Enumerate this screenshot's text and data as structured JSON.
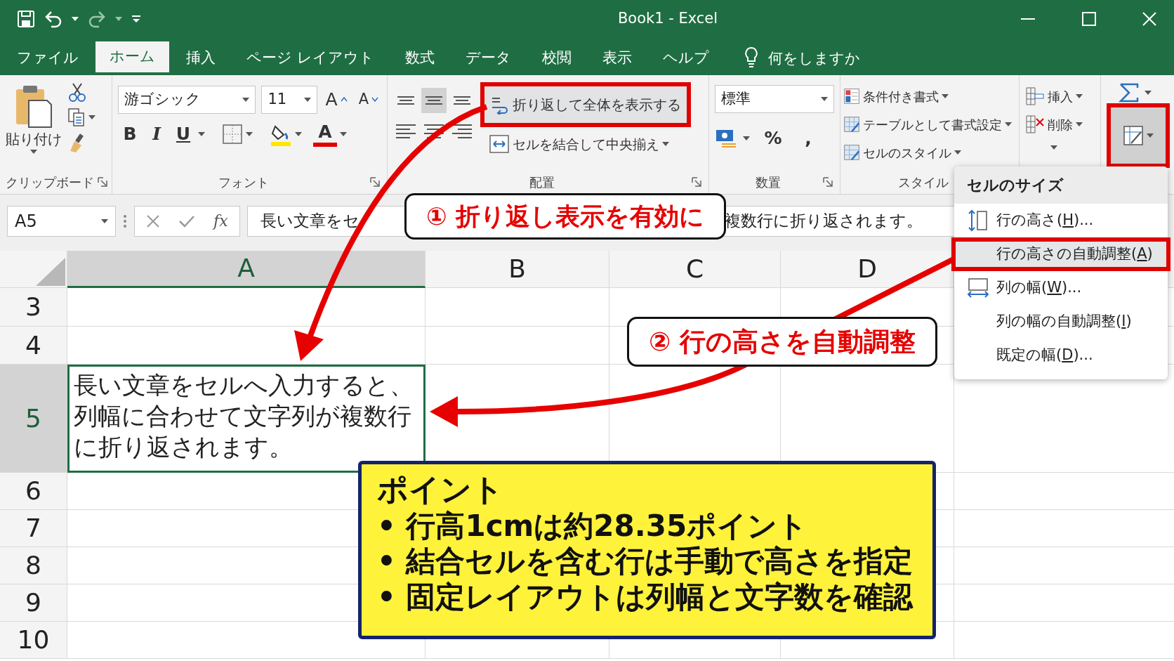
{
  "window": {
    "title": "Book1  -  Excel"
  },
  "tabs": [
    {
      "label": "ファイル",
      "selected": false
    },
    {
      "label": "ホーム",
      "selected": true
    },
    {
      "label": "挿入",
      "selected": false
    },
    {
      "label": "ページ レイアウト",
      "selected": false
    },
    {
      "label": "数式",
      "selected": false
    },
    {
      "label": "データ",
      "selected": false
    },
    {
      "label": "校閲",
      "selected": false
    },
    {
      "label": "表示",
      "selected": false
    },
    {
      "label": "ヘルプ",
      "selected": false
    }
  ],
  "tell_me": "何をしますか",
  "clipboard": {
    "label": "クリップボード",
    "paste": "貼り付け"
  },
  "font": {
    "label": "フォント",
    "font_name": "游ゴシック",
    "font_size": "11",
    "grow_font": "A",
    "shrink_font": "A",
    "bold": "B",
    "italic": "I",
    "underline": "U",
    "font_color": "A"
  },
  "alignment": {
    "label": "配置",
    "align_buttons": [
      {
        "selected": false
      },
      {
        "selected": true
      },
      {
        "selected": false
      },
      {
        "selected": false
      },
      {
        "selected": false
      },
      {
        "selected": false
      }
    ],
    "wrap_text": {
      "label": "折り返して全体を表示する",
      "highlighted": true
    },
    "merge": {
      "label": "セルを結合して中央揃え"
    }
  },
  "number": {
    "label": "数置",
    "format": "標準",
    "percent": "%",
    "comma": ","
  },
  "styles": {
    "label": "スタイル",
    "items": [
      "条件付き書式",
      "テーブルとして書式設定",
      "セルのスタイル"
    ]
  },
  "cells": {
    "insert": "挿入",
    "delete": "削除"
  },
  "editing": {
    "format_highlighted": true
  },
  "formula_bar": {
    "name_box": "A5",
    "fx": "fx",
    "value_parts": [
      "長い文章をセ",
      "複数行に折り返されます。"
    ]
  },
  "grid": {
    "columns": [
      {
        "label": "A",
        "selected": true
      },
      {
        "label": "B",
        "selected": false
      },
      {
        "label": "C",
        "selected": false
      },
      {
        "label": "D",
        "selected": false
      }
    ],
    "rows": [
      {
        "label": "3",
        "selected": false
      },
      {
        "label": "4",
        "selected": false
      },
      {
        "label": "5",
        "selected": true,
        "cells": [
          {
            "lines": [
              "長い文章をセルへ入力すると、",
              "列幅に合わせて文字列が複数行",
              "に折り返されます。"
            ],
            "selected": true
          }
        ]
      },
      {
        "label": "6",
        "selected": false
      },
      {
        "label": "7",
        "selected": false
      },
      {
        "label": "8",
        "selected": false
      },
      {
        "label": "9",
        "selected": false
      },
      {
        "label": "10",
        "selected": false
      }
    ]
  },
  "callouts": [
    "① 折り返し表示を有効に",
    "② 行の高さを自動調整"
  ],
  "menu": {
    "title": "セルのサイズ",
    "items": [
      {
        "kind": "row-height",
        "before": "行の高さ(",
        "key": "H",
        "after": ")...",
        "highlighted": false
      },
      {
        "kind": "plain",
        "before": "行の高さの自動調整(",
        "key": "A",
        "after": ")",
        "highlighted": true
      },
      {
        "kind": "column-width",
        "before": "列の幅(",
        "key": "W",
        "after": ")...",
        "highlighted": false
      },
      {
        "kind": "plain",
        "before": "列の幅の自動調整(",
        "key": "I",
        "after": ")",
        "highlighted": false
      },
      {
        "kind": "plain",
        "before": "既定の幅(",
        "key": "D",
        "after": ")...",
        "highlighted": false
      }
    ]
  },
  "point": {
    "title": "ポイント",
    "bullets": [
      "• 行高1cmは約28.35ポイント",
      "• 結合セルを含む行は手動で高さを指定",
      "• 固定レイアウトは列幅と文字数を確認"
    ]
  }
}
